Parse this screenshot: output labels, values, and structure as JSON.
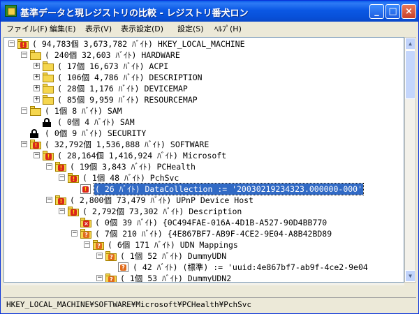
{
  "window": {
    "title": "基準データと現レジストリの比較 - レジストリ番犬ロン",
    "minimize_label": "_",
    "maximize_label": "□",
    "close_label": "×"
  },
  "menu": [
    {
      "label": "ファイル(F)"
    },
    {
      "label": "編集(E)"
    },
    {
      "label": "表示(V)"
    },
    {
      "label": "表示設定(D)"
    },
    {
      "label": "設定(S)"
    },
    {
      "label": "ﾍﾙﾌﾟ(H)"
    }
  ],
  "tree": [
    {
      "depth": 0,
      "expander": "-",
      "icon": "folder",
      "badge": "warn",
      "text": "( 94,783個  3,673,782 ﾊﾞｲﾄ) HKEY_LOCAL_MACHINE"
    },
    {
      "depth": 1,
      "expander": "-",
      "icon": "folder",
      "badge": "",
      "text": "(    240個    32,603 ﾊﾞｲﾄ) HARDWARE"
    },
    {
      "depth": 2,
      "expander": "+",
      "icon": "folder",
      "badge": "",
      "text": "(     17個    16,673 ﾊﾞｲﾄ) ACPI"
    },
    {
      "depth": 2,
      "expander": "+",
      "icon": "folder",
      "badge": "",
      "text": "(    106個     4,786 ﾊﾞｲﾄ) DESCRIPTION"
    },
    {
      "depth": 2,
      "expander": "+",
      "icon": "folder",
      "badge": "",
      "text": "(     28個     1,176 ﾊﾞｲﾄ) DEVICEMAP"
    },
    {
      "depth": 2,
      "expander": "+",
      "icon": "folder",
      "badge": "",
      "text": "(     85個     9,959 ﾊﾞｲﾄ) RESOURCEMAP"
    },
    {
      "depth": 1,
      "expander": "-",
      "icon": "folder",
      "badge": "",
      "text": "(      1個         8 ﾊﾞｲﾄ) SAM"
    },
    {
      "depth": 2,
      "expander": "",
      "icon": "lock",
      "badge": "",
      "text": "(      0個         4 ﾊﾞｲﾄ) SAM"
    },
    {
      "depth": 1,
      "expander": "",
      "icon": "lock",
      "badge": "",
      "text": "(      0個         9 ﾊﾞｲﾄ) SECURITY"
    },
    {
      "depth": 1,
      "expander": "-",
      "icon": "folder",
      "badge": "warn",
      "text": "( 32,792個  1,536,888 ﾊﾞｲﾄ) SOFTWARE"
    },
    {
      "depth": 2,
      "expander": "-",
      "icon": "folder",
      "badge": "warn",
      "text": "( 28,164個  1,416,924 ﾊﾞｲﾄ) Microsoft"
    },
    {
      "depth": 3,
      "expander": "-",
      "icon": "folder",
      "badge": "warn",
      "text": "(     19個     3,843 ﾊﾞｲﾄ) PCHealth"
    },
    {
      "depth": 4,
      "expander": "-",
      "icon": "folder",
      "badge": "warn",
      "text": "(      1個        48 ﾊﾞｲﾄ) PchSvc"
    },
    {
      "depth": 5,
      "expander": "",
      "icon": "value",
      "badge": "warn",
      "selected": true,
      "text": "(      26 ﾊﾞｲﾄ) DataCollection := '20030219234323.000000-000'"
    },
    {
      "depth": 3,
      "expander": "-",
      "icon": "folder",
      "badge": "warn",
      "text": "(  2,800個    73,479 ﾊﾞｲﾄ) UPnP Device Host"
    },
    {
      "depth": 4,
      "expander": "-",
      "icon": "folder",
      "badge": "warn",
      "text": "(  2,792個    73,302 ﾊﾞｲﾄ) Description"
    },
    {
      "depth": 5,
      "expander": "",
      "icon": "folder",
      "badge": "err",
      "text": "(      0個        39 ﾊﾞｲﾄ) {0C494FAE-016A-4D1B-A527-90D4BB770"
    },
    {
      "depth": 5,
      "expander": "-",
      "icon": "folder",
      "badge": "ques",
      "text": "(      7個       210 ﾊﾞｲﾄ) {4E867BF7-AB9F-4CE2-9E04-A8B42BD89"
    },
    {
      "depth": 6,
      "expander": "-",
      "icon": "folder",
      "badge": "ques",
      "text": "(      6個       171 ﾊﾞｲﾄ) UDN Mappings"
    },
    {
      "depth": 7,
      "expander": "-",
      "icon": "folder",
      "badge": "ques",
      "text": "(      1個        52 ﾊﾞｲﾄ) DummyUDN"
    },
    {
      "depth": 8,
      "expander": "",
      "icon": "value",
      "badge": "ques",
      "text": "(      42 ﾊﾞｲﾄ) (標準) := 'uuid:4e867bf7-ab9f-4ce2-9e04"
    },
    {
      "depth": 7,
      "expander": "-",
      "icon": "folder",
      "badge": "ques",
      "text": "(      1個        53 ﾊﾞｲﾄ) DummyUDN2"
    }
  ],
  "status": {
    "path": "HKEY_LOCAL_MACHINE¥SOFTWARE¥Microsoft¥PCHealth¥PchSvc"
  },
  "colors": {
    "titlebar": "#0b58e4",
    "selection": "#316ac5",
    "folder": "#f5d64e",
    "warn_badge": "#d9261c",
    "question_badge": "#e06a1b"
  }
}
